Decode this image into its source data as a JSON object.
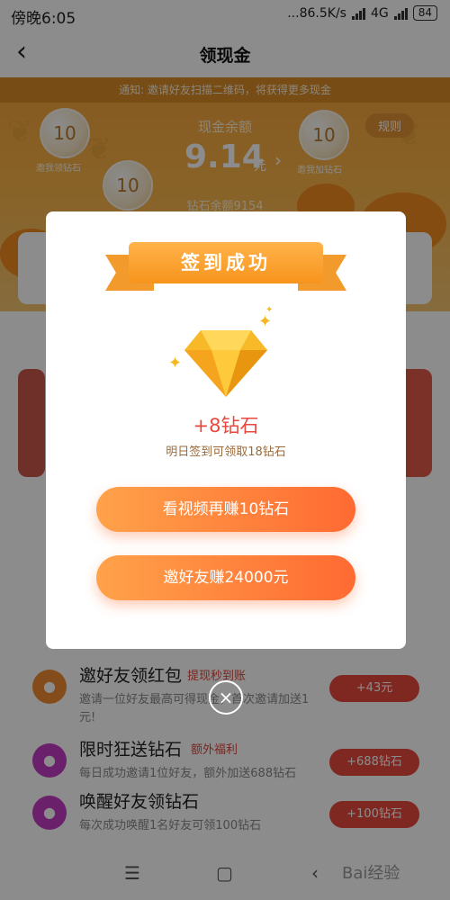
{
  "status_bar": {
    "time": "傍晚6:05",
    "network_speed": "...86.5K/s",
    "network_type": "4G",
    "battery": "84"
  },
  "nav": {
    "title": "领现金"
  },
  "banner": {
    "notice": "通知: 邀请好友扫描二维码，将获得更多现金",
    "bubble_value": "10",
    "bubble_label_left": "邀我领钻石",
    "bubble_label_right": "邀我加钻石",
    "balance_label": "现金余额",
    "balance": "9.14",
    "balance_unit": "元",
    "rules": "规则",
    "diamond_balance": "钻石余额9154"
  },
  "tasks": [
    {
      "title": "邀好友领红包",
      "tag": "提现秒到账",
      "desc": "邀请一位好友最高可得现金，首次邀请加送1元!",
      "button": "+43元",
      "color": "#f08a32"
    },
    {
      "title": "限时狂送钻石",
      "tag": "额外福利",
      "desc": "每日成功邀请1位好友，额外加送688钻石",
      "button": "+688钻石",
      "color": "#c23bc4"
    },
    {
      "title": "唤醒好友领钻石",
      "tag": "",
      "desc": "每次成功唤醒1名好友可领100钻石",
      "button": "+100钻石",
      "color": "#c23bc4"
    }
  ],
  "modal": {
    "ribbon": "签到成功",
    "reward": "+8钻石",
    "reward_sub": "明日签到可领取18钻石",
    "button_video": "看视频再赚10钻石",
    "button_invite": "邀好友赚24000元",
    "close": "×"
  },
  "watermark": "Bai经验",
  "icons": {
    "back": "chevron-left-icon",
    "close": "close-icon",
    "diamond": "diamond-icon"
  },
  "colors": {
    "accent": "#ff7a3a",
    "reward_red": "#e8493e",
    "banner": "#f5a23c"
  }
}
